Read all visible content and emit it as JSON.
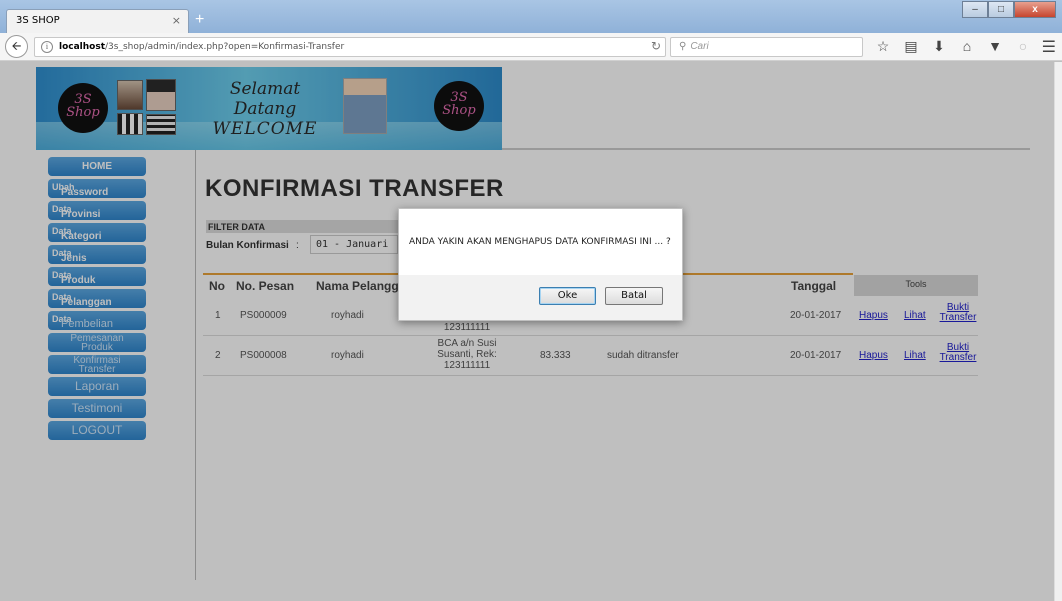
{
  "browser": {
    "tab_title": "3S SHOP",
    "tab_close": "×",
    "new_tab": "+",
    "url_host": "localhost",
    "url_path": "/3s_shop/admin/index.php?open=Konfirmasi-Transfer",
    "search_placeholder": "Cari",
    "window_buttons": [
      "–",
      "□",
      "x"
    ]
  },
  "banner": {
    "logo_text_top": "3S",
    "logo_text_bottom": "Shop",
    "welcome_line1": "Selamat Datang",
    "welcome_line2": "WELCOME"
  },
  "sidebar": {
    "items": [
      {
        "pre": "",
        "main": "",
        "label": "HOME"
      },
      {
        "pre": "Ubah",
        "main": "Password",
        "label": ""
      },
      {
        "pre": "Data",
        "main": "Provinsi",
        "label": ""
      },
      {
        "pre": "Data",
        "main": "Kategori",
        "label": ""
      },
      {
        "pre": "Data",
        "main": "Jenis",
        "label": ""
      },
      {
        "pre": "Data",
        "main": "Produk",
        "label": ""
      },
      {
        "pre": "Data",
        "main": "Pelanggan",
        "label": ""
      },
      {
        "pre": "Data",
        "main": "Pembelian",
        "label": ""
      },
      {
        "line1": "Pemesanan",
        "line2": "Produk"
      },
      {
        "line1": "Konfirmasi",
        "line2": "Transfer"
      },
      {
        "label": "Laporan"
      },
      {
        "label": "Testimoni"
      },
      {
        "label": "LOGOUT"
      }
    ]
  },
  "main": {
    "heading": "KONFIRMASI TRANSFER",
    "filter_title": "FILTER DATA",
    "filter_label": "Bulan Konfirmasi",
    "filter_colon": ":",
    "filter_value": "01 - Januari",
    "columns": {
      "no": "No",
      "order": "No. Pesan",
      "customer": "Nama Pelanggan",
      "date": "Tanggal",
      "tools": "Tools"
    },
    "rows": [
      {
        "no": "1",
        "order": "PS000009",
        "customer": "royhadi",
        "bank_line3": "123111111",
        "date": "20-01-2017",
        "delete": "Hapus",
        "view": "Lihat",
        "proof_line1": "Bukti",
        "proof_line2": "Transfer"
      },
      {
        "no": "2",
        "order": "PS000008",
        "customer": "royhadi",
        "bank_line1": "BCA a/n Susi",
        "bank_line2": "Susanti, Rek:",
        "bank_line3": "123111111",
        "amount": "83.333",
        "status": "sudah ditransfer",
        "date": "20-01-2017",
        "delete": "Hapus",
        "view": "Lihat",
        "proof_line1": "Bukti",
        "proof_line2": "Transfer"
      }
    ]
  },
  "dialog": {
    "message": "ANDA YAKIN AKAN MENGHAPUS DATA KONFIRMASI INI ... ?",
    "ok_label": "Oke",
    "cancel_label": "Batal"
  }
}
